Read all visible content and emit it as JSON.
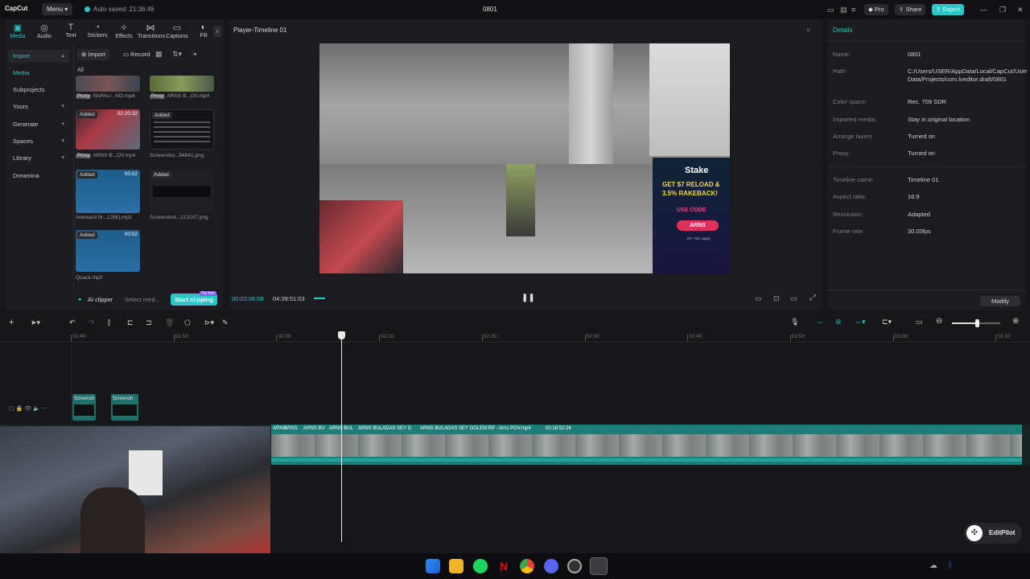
{
  "titlebar": {
    "logo": "CapCut",
    "menu": "Menu",
    "autosave": "Auto saved: 21:36:46",
    "title": "0801",
    "pro": "Pro",
    "share": "Share",
    "export": "Export"
  },
  "tools": [
    {
      "label": "Media",
      "icon": "media-icon"
    },
    {
      "label": "Audio",
      "icon": "audio-icon"
    },
    {
      "label": "Text",
      "icon": "text-icon"
    },
    {
      "label": "Stickers",
      "icon": "stickers-icon"
    },
    {
      "label": "Effects",
      "icon": "effects-icon"
    },
    {
      "label": "Transitions",
      "icon": "transitions-icon"
    },
    {
      "label": "Captions",
      "icon": "captions-icon"
    },
    {
      "label": "Filt",
      "icon": "filters-icon"
    }
  ],
  "sidebar": {
    "import": "Import",
    "media": "Media",
    "subprojects": "Subprojects",
    "yours": "Yours",
    "generate": "Generate",
    "spaces": "Spaces",
    "library": "Library",
    "dreamina": "Dreamina"
  },
  "media_toolbar": {
    "import": "Import",
    "record": "Record"
  },
  "media_filter": "All",
  "media_items": [
    {
      "name": "NAPALI...NO.mp4",
      "proxy": "Proxy",
      "status": "",
      "duration": ""
    },
    {
      "name": "ARNS B...OV.mp4",
      "proxy": "Proxy",
      "status": "",
      "duration": ""
    },
    {
      "name": "ARNS B...OV.mp4",
      "proxy": "Proxy",
      "status": "Added",
      "duration": "02:20:32"
    },
    {
      "name": "Screensho...94841.png",
      "proxy": "",
      "status": "Added",
      "duration": ""
    },
    {
      "name": "Awkward M...128k).mp3",
      "proxy": "",
      "status": "Added",
      "duration": "00:02"
    },
    {
      "name": "Screenshot...213107.png",
      "proxy": "",
      "status": "Added",
      "duration": ""
    },
    {
      "name": "Quack.mp3",
      "proxy": "",
      "status": "Added",
      "duration": "00:02"
    }
  ],
  "bottom_left": {
    "ai_clipper": "AI clipper",
    "select": "Select med...",
    "start": "Start clipping",
    "try": "Try free"
  },
  "player": {
    "title": "Player-Timeline 01",
    "current": "00:02:06:08",
    "total": "04:39:51:03",
    "overlay_ad": {
      "brand": "Stake",
      "line1": "GET $7 RELOAD &",
      "line2": "3.5% RAKEBACK!",
      "use_code": "USE CODE",
      "code": "ARNS",
      "terms": "18+ T&C apply"
    }
  },
  "details": {
    "header": "Details",
    "rows": [
      {
        "label": "Name:",
        "value": "0801"
      },
      {
        "label": "Path:",
        "value": "C:/Users/USER/AppData/Local/CapCut/User Data/Projects/com.lveditor.draft/0801"
      },
      {
        "label": "Color space:",
        "value": "Rec. 709 SDR"
      },
      {
        "label": "Imported media:",
        "value": "Stay in original location"
      },
      {
        "label": "Arrange layers",
        "value": "Turned on"
      },
      {
        "label": "Proxy:",
        "value": "Turned on"
      },
      {
        "label": "Timeline name:",
        "value": "Timeline 01"
      },
      {
        "label": "Aspect ratio:",
        "value": "16:9"
      },
      {
        "label": "Resolution:",
        "value": "Adapted"
      },
      {
        "label": "Frame rate:",
        "value": "30.00fps"
      }
    ],
    "modify": "Modify"
  },
  "timeline": {
    "ticks": [
      "01:40",
      "01:50",
      "02:00",
      "02:10",
      "02:20",
      "02:30",
      "02:40",
      "02:50",
      "03:00",
      "03:10"
    ],
    "track_clips": [
      "Screensh",
      "Screensh"
    ],
    "main_clips": [
      "ARNS",
      "ARNS",
      "ARNS BU",
      "ARNS BUL",
      "ARNS BULADAS SEY G",
      "ARNS BULADAS SEY GOLEM RP - Arns POV.mp4"
    ],
    "main_duration": "02:18:52:26"
  },
  "editpilot": "EditPilot",
  "colors": {
    "accent": "#2cc6c9",
    "clip": "#1f8a86",
    "bg": "#17171a"
  }
}
